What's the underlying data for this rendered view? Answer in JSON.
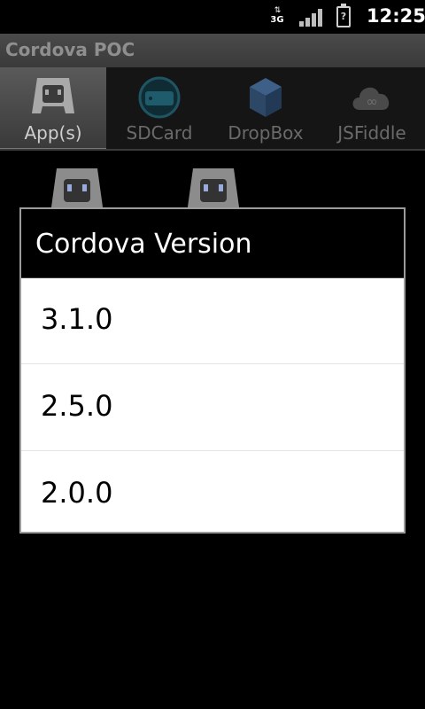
{
  "status": {
    "network_label": "3G",
    "time": "12:25",
    "battery_icon": "battery-unknown-icon"
  },
  "app": {
    "title": "Cordova POC"
  },
  "tabs": [
    {
      "label": "App(s)",
      "icon": "cordova-icon",
      "active": true
    },
    {
      "label": "SDCard",
      "icon": "sdcard-icon",
      "active": false
    },
    {
      "label": "DropBox",
      "icon": "dropbox-icon",
      "active": false
    },
    {
      "label": "JSFiddle",
      "icon": "cloud-icon",
      "active": false
    }
  ],
  "dialog": {
    "title": "Cordova Version",
    "options": [
      "3.1.0",
      "2.5.0",
      "2.0.0"
    ]
  }
}
